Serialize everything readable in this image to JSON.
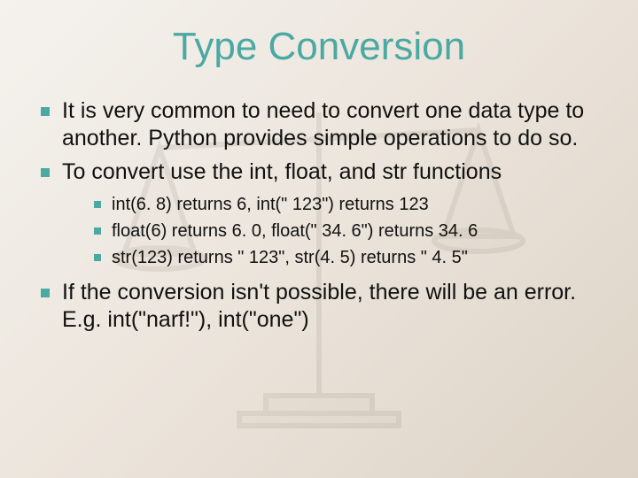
{
  "title": "Type Conversion",
  "bullets": {
    "b1": "It is very common to need to convert one data type to another.  Python provides simple operations to do so.",
    "b2": "To convert use the int, float, and str functions",
    "b3": "If the conversion isn't possible, there will be an error.  E.g. int(\"narf!\"), int(\"one\")"
  },
  "sub": {
    "s1": "int(6. 8) returns 6, int(\" 123\") returns 123",
    "s2": "float(6) returns 6. 0, float(\" 34. 6\") returns 34. 6",
    "s3": "str(123) returns \" 123\", str(4. 5) returns \" 4. 5\""
  }
}
